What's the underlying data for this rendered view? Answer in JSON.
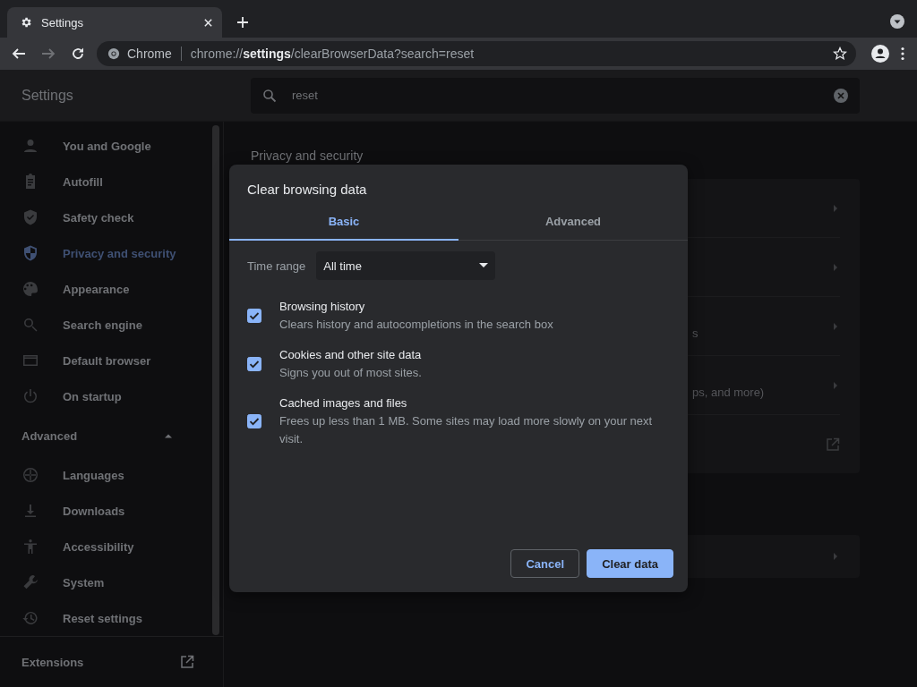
{
  "browser": {
    "tab": {
      "title": "Settings"
    },
    "omnibox": {
      "site_label": "Chrome",
      "url": "chrome://**settings**/clearBrowserData?search=reset"
    },
    "forward_disabled": true
  },
  "header": {
    "title": "Settings",
    "search": {
      "value": "reset"
    }
  },
  "sidebar": {
    "items": [
      {
        "label": "You and Google",
        "kind": "person",
        "selected": false
      },
      {
        "label": "Autofill",
        "kind": "clipboard",
        "selected": false
      },
      {
        "label": "Safety check",
        "kind": "shield-check",
        "selected": false
      },
      {
        "label": "Privacy and security",
        "kind": "shield",
        "selected": true
      },
      {
        "label": "Appearance",
        "kind": "palette",
        "selected": false
      },
      {
        "label": "Search engine",
        "kind": "search",
        "selected": false
      },
      {
        "label": "Default browser",
        "kind": "window",
        "selected": false
      },
      {
        "label": "On startup",
        "kind": "power",
        "selected": false
      }
    ],
    "advanced": {
      "label": "Advanced",
      "expanded": true,
      "items": [
        {
          "label": "Languages",
          "kind": "globe",
          "selected": false
        },
        {
          "label": "Downloads",
          "kind": "download",
          "selected": false
        },
        {
          "label": "Accessibility",
          "kind": "figure",
          "selected": false
        },
        {
          "label": "System",
          "kind": "wrench",
          "selected": false
        },
        {
          "label": "Reset settings",
          "kind": "history",
          "selected": false
        }
      ]
    },
    "extensions": {
      "label": "Extensions"
    }
  },
  "main": {
    "section_title": "Privacy and security",
    "rows": [
      {
        "kind": "chevron"
      },
      {
        "kind": "chevron"
      },
      {
        "kind": "chevron",
        "text": "s"
      },
      {
        "kind": "chevron",
        "text": "ps, and more)"
      },
      {
        "kind": "external"
      }
    ],
    "second_card": [
      {
        "kind": "chevron"
      }
    ]
  },
  "dialog": {
    "title": "Clear browsing data",
    "tabs": [
      {
        "label": "Basic",
        "selected": true
      },
      {
        "label": "Advanced",
        "selected": false
      }
    ],
    "time_range": {
      "label": "Time range",
      "value": "All time"
    },
    "options": [
      {
        "title": "Browsing history",
        "description": "Clears history and autocompletions in the search box",
        "checked": true
      },
      {
        "title": "Cookies and other site data",
        "description": "Signs you out of most sites.",
        "checked": true
      },
      {
        "title": "Cached images and files",
        "description": "Frees up less than 1 MB. Some sites may load more slowly on your next visit.",
        "checked": true
      }
    ],
    "buttons": [
      {
        "label": "Cancel",
        "kind": "secondary"
      },
      {
        "label": "Clear data",
        "kind": "primary"
      }
    ]
  }
}
